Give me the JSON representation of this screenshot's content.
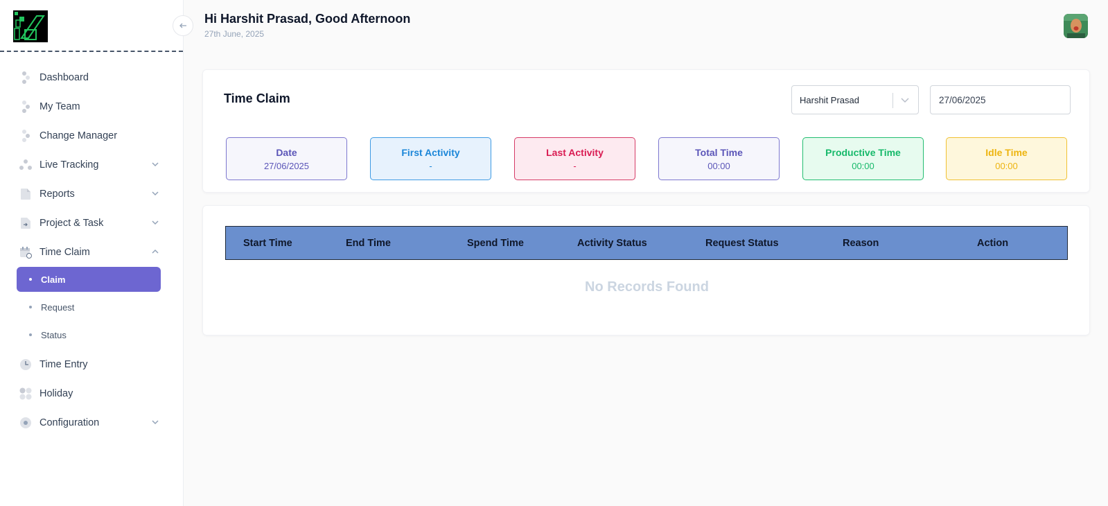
{
  "header": {
    "greeting": "Hi Harshit Prasad, Good Afternoon",
    "date": "27th June, 2025"
  },
  "sidebar": {
    "items": [
      {
        "label": "Dashboard",
        "icon": "dashboard-icon"
      },
      {
        "label": "My Team",
        "icon": "team-icon"
      },
      {
        "label": "Change Manager",
        "icon": "change-manager-icon"
      },
      {
        "label": "Live Tracking",
        "icon": "live-tracking-icon"
      },
      {
        "label": "Reports",
        "icon": "reports-icon"
      },
      {
        "label": "Project & Task",
        "icon": "project-task-icon"
      },
      {
        "label": "Time Claim",
        "icon": "calendar-icon"
      },
      {
        "label": "Time Entry",
        "icon": "clock-icon"
      },
      {
        "label": "Holiday",
        "icon": "holiday-icon"
      },
      {
        "label": "Configuration",
        "icon": "gear-icon"
      }
    ],
    "time_claim_sub": [
      {
        "label": "Claim",
        "active": true
      },
      {
        "label": "Request",
        "active": false
      },
      {
        "label": "Status",
        "active": false
      }
    ]
  },
  "time_claim": {
    "title": "Time Claim",
    "employee_select": "Harshit Prasad",
    "date_value": "27/06/2025"
  },
  "stats": [
    {
      "title": "Date",
      "value": "27/06/2025",
      "color": "#5b55b8",
      "bg": "#f6f6fc",
      "border": "#7d77cf"
    },
    {
      "title": "First Activity",
      "value": "-",
      "color": "#1b86d8",
      "bg": "#e7f2fd",
      "border": "#3d9ae3"
    },
    {
      "title": "Last Activity",
      "value": "-",
      "color": "#d91b52",
      "bg": "#fdeaf0",
      "border": "#d63a66"
    },
    {
      "title": "Total Time",
      "value": "00:00",
      "color": "#5b55b8",
      "bg": "#f6f6fc",
      "border": "#7d77cf"
    },
    {
      "title": "Productive Time",
      "value": "00:00",
      "color": "#16b96a",
      "bg": "#e7fbef",
      "border": "#22bd70"
    },
    {
      "title": "Idle Time",
      "value": "00:00",
      "color": "#edb40f",
      "bg": "#fef7dc",
      "border": "#f0c132"
    }
  ],
  "table": {
    "columns": [
      "Start Time",
      "End Time",
      "Spend Time",
      "Activity Status",
      "Request Status",
      "Reason",
      "Action"
    ],
    "empty_text": "No Records Found",
    "header_bg": "#6a8fce"
  },
  "colors": {
    "accent": "#6d66d1"
  }
}
